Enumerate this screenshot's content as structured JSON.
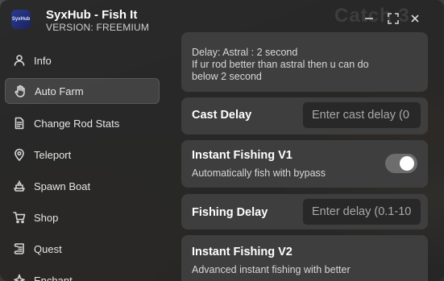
{
  "app": {
    "title": "SyxHub - Fish It",
    "version": "VERSION: FREEMIUM",
    "logo_text": "SyxHub",
    "background_text": "Catch 3"
  },
  "header": {
    "controls": [
      {
        "name": "minimize",
        "glyph": "—"
      },
      {
        "name": "maximize",
        "glyph": "⛶"
      },
      {
        "name": "close",
        "glyph": "✕"
      }
    ]
  },
  "sidebar": {
    "items": [
      {
        "label": "Info",
        "icon": "user-icon",
        "active": false
      },
      {
        "label": "Auto Farm",
        "icon": "hand-icon",
        "active": true
      },
      {
        "label": "Change Rod Stats",
        "icon": "file-icon",
        "active": false
      },
      {
        "label": "Teleport",
        "icon": "map-pin-icon",
        "active": false
      },
      {
        "label": "Spawn Boat",
        "icon": "ship-icon",
        "active": false
      },
      {
        "label": "Shop",
        "icon": "cart-icon",
        "active": false
      },
      {
        "label": "Quest",
        "icon": "scroll-icon",
        "active": false
      },
      {
        "label": "Enchant",
        "icon": "sparkle-icon",
        "active": false
      }
    ]
  },
  "main": {
    "delay_note": {
      "line1": "Delay: Astral : 2 second",
      "line2": "If ur rod better than astral then u can do",
      "line3": "below 2 second"
    },
    "cast_delay": {
      "title": "Cast Delay",
      "placeholder": "Enter cast delay (0"
    },
    "instant_v1": {
      "title": "Instant Fishing V1",
      "desc": "Automatically fish with bypass",
      "enabled": true
    },
    "fishing_delay": {
      "title": "Fishing Delay",
      "placeholder": "Enter delay (0.1-10"
    },
    "instant_v2": {
      "title": "Instant Fishing V2",
      "desc": "Advanced instant fishing with better"
    }
  }
}
